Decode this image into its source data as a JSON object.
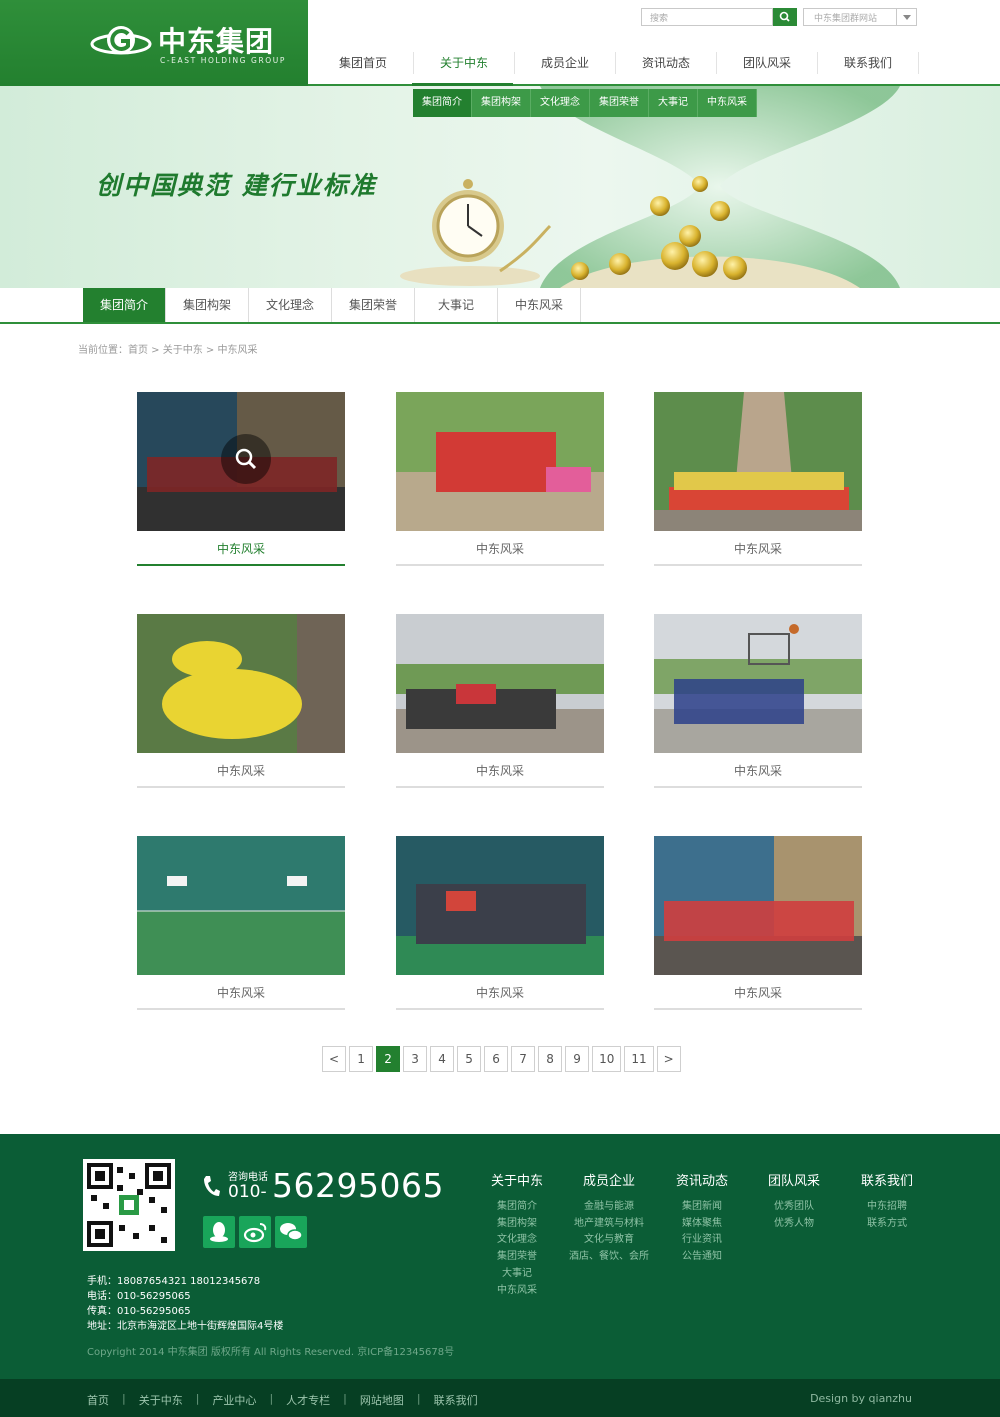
{
  "header": {
    "logo_cn": "中东集团",
    "logo_en": "C-EAST HOLDING GROUP",
    "search_placeholder": "搜索",
    "group_select": "中东集团群网站",
    "nav": [
      "集团首页",
      "关于中东",
      "成员企业",
      "资讯动态",
      "团队风采",
      "联系我们"
    ],
    "active_nav": "关于中东"
  },
  "banner": {
    "subnav": [
      "集团简介",
      "集团构架",
      "文化理念",
      "集团荣誉",
      "大事记",
      "中东风采"
    ],
    "slogan": "创中国典范  建行业标准"
  },
  "tabs": [
    "集团简介",
    "集团构架",
    "文化理念",
    "集团荣誉",
    "大事记",
    "中东风采"
  ],
  "breadcrumb": "当前位置：首页 > 关于中东 > 中东风采",
  "gallery": {
    "items": [
      {
        "caption": "中东风采",
        "active": true
      },
      {
        "caption": "中东风采"
      },
      {
        "caption": "中东风采"
      },
      {
        "caption": "中东风采"
      },
      {
        "caption": "中东风采"
      },
      {
        "caption": "中东风采"
      },
      {
        "caption": "中东风采"
      },
      {
        "caption": "中东风采"
      },
      {
        "caption": "中东风采"
      }
    ]
  },
  "pagination": {
    "prev": "<",
    "next": ">",
    "pages": [
      "1",
      "2",
      "3",
      "4",
      "5",
      "6",
      "7",
      "8",
      "9",
      "10",
      "11"
    ],
    "current": "2"
  },
  "footer": {
    "hotline_label": "咨询电话",
    "hotline_prefix": "010-",
    "hotline_number": "56295065",
    "mobile": "手机：18087654321  18012345678",
    "tel": "电话：010-56295065",
    "fax": "传真：010-56295065",
    "address": "地址：北京市海淀区上地十街辉煌国际4号楼",
    "columns": [
      {
        "title": "关于中东",
        "links": [
          "集团简介",
          "集团构架",
          "文化理念",
          "集团荣誉",
          "大事记",
          "中东风采"
        ]
      },
      {
        "title": "成员企业",
        "links": [
          "金融与能源",
          "地产建筑与材料",
          "文化与教育",
          "酒店、餐饮、会所"
        ]
      },
      {
        "title": "资讯动态",
        "links": [
          "集团新闻",
          "媒体聚焦",
          "行业资讯",
          "公告通知"
        ]
      },
      {
        "title": "团队风采",
        "links": [
          "优秀团队",
          "优秀人物"
        ]
      },
      {
        "title": "联系我们",
        "links": [
          "中东招聘",
          "联系方式"
        ]
      }
    ],
    "copyright": "Copyright 2014 中东集团 版权所有 All Rights Reserved.   京ICP备12345678号",
    "bottom_links": [
      "首页",
      "关于中东",
      "产业中心",
      "人才专栏",
      "网站地图",
      "联系我们"
    ],
    "credit": "Design by qianzhu"
  },
  "colors": {
    "brand_green": "#23802f",
    "footer_green": "#0b5d36",
    "footer_bottom": "#063f23"
  },
  "icons": [
    "search-icon",
    "chevron-down-icon",
    "zoom-icon",
    "phone-icon",
    "qq-icon",
    "weibo-icon",
    "wechat-icon",
    "qr-code"
  ]
}
